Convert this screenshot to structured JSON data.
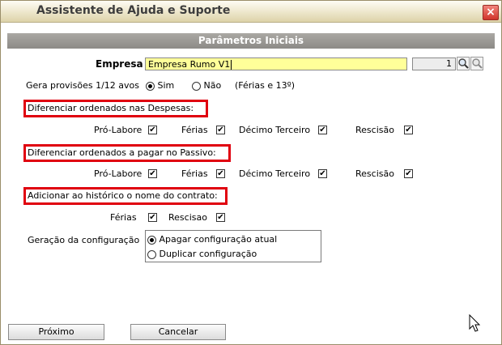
{
  "window": {
    "title": "Assistente de Ajuda e Suporte",
    "close_label": "×"
  },
  "section": {
    "title": "Parâmetros Iniciais"
  },
  "empresa": {
    "label": "Empresa",
    "value": "Empresa Rumo V1",
    "code": "1"
  },
  "provisoes": {
    "label": "Gera provisões 1/12 avos",
    "options": [
      "Sim",
      "Não"
    ],
    "selected": "Sim",
    "note": "(Férias e 13º)"
  },
  "despesas": {
    "heading": "Diferenciar ordenados nas Despesas:",
    "items": [
      {
        "label": "Pró-Labore",
        "checked": true
      },
      {
        "label": "Férias",
        "checked": true
      },
      {
        "label": "Décimo Terceiro",
        "checked": true
      },
      {
        "label": "Rescisão",
        "checked": true
      }
    ]
  },
  "passivo": {
    "heading": "Diferenciar ordenados a pagar no Passivo:",
    "items": [
      {
        "label": "Pró-Labore",
        "checked": true
      },
      {
        "label": "Férias",
        "checked": true
      },
      {
        "label": "Décimo Terceiro",
        "checked": true
      },
      {
        "label": "Rescisão",
        "checked": true
      }
    ]
  },
  "historico": {
    "heading": "Adicionar ao histórico o nome do contrato:",
    "items": [
      {
        "label": "Férias",
        "checked": true
      },
      {
        "label": "Rescisao",
        "checked": true
      }
    ]
  },
  "configuracao": {
    "label": "Geração da configuração",
    "options": [
      "Apagar configuração atual",
      "Duplicar configuração"
    ],
    "selected": "Apagar configuração atual"
  },
  "buttons": {
    "next": "Próximo",
    "cancel": "Cancelar"
  },
  "check_mark": "✔",
  "colors": {
    "highlight_border": "#e0000f",
    "input_bg": "#ffff99",
    "close_bg": "#d0342a"
  }
}
